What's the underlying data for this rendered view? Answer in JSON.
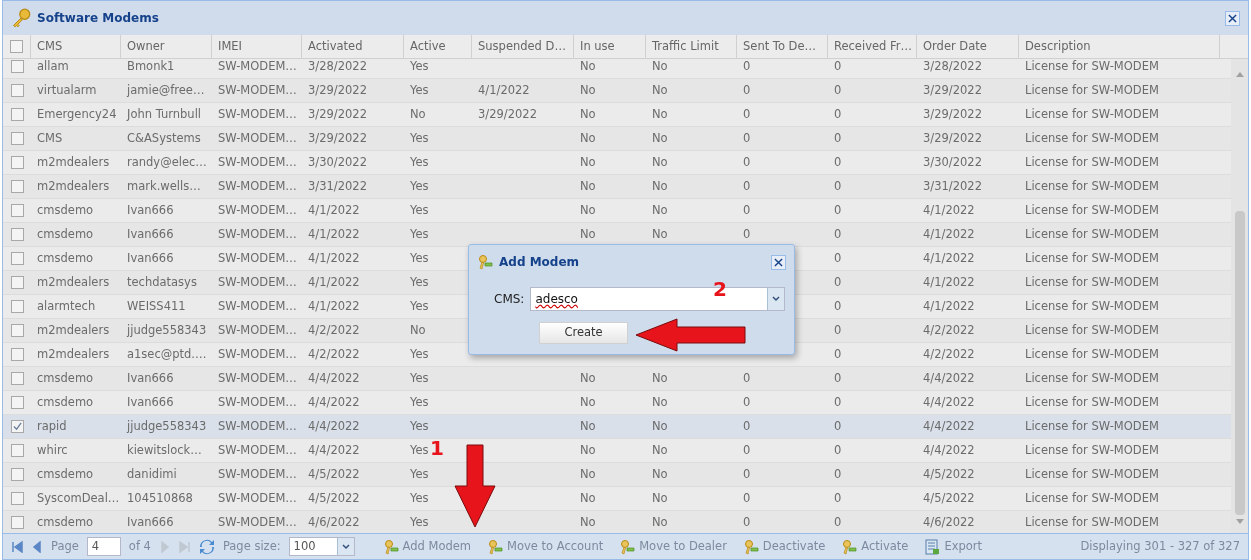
{
  "window": {
    "title": "Software Modems"
  },
  "table": {
    "columns": [
      "CMS",
      "Owner",
      "IMEI",
      "Activated",
      "Active",
      "Suspended D…",
      "In use",
      "Traffic Limit",
      "Sent To De…",
      "Received Fr…",
      "Order Date",
      "Description"
    ],
    "header_checked": false,
    "rows": [
      {
        "checked": false,
        "selected": false,
        "cells": [
          "allam",
          "Bmonk1",
          "SW-MODEM…",
          "3/28/2022",
          "Yes",
          "",
          "No",
          "No",
          "0",
          "0",
          "3/28/2022",
          "License for SW-MODEM"
        ]
      },
      {
        "checked": false,
        "selected": false,
        "cells": [
          "virtualarm",
          "jamie@free…",
          "SW-MODEM…",
          "3/29/2022",
          "Yes",
          "4/1/2022",
          "No",
          "No",
          "0",
          "0",
          "3/29/2022",
          "License for SW-MODEM"
        ]
      },
      {
        "checked": false,
        "selected": false,
        "cells": [
          "Emergency24",
          "John Turnbull",
          "SW-MODEM…",
          "3/29/2022",
          "No",
          "3/29/2022",
          "No",
          "No",
          "0",
          "0",
          "3/29/2022",
          "License for SW-MODEM"
        ]
      },
      {
        "checked": false,
        "selected": false,
        "cells": [
          "CMS",
          "C&ASystems",
          "SW-MODEM…",
          "3/29/2022",
          "Yes",
          "",
          "No",
          "No",
          "0",
          "0",
          "3/29/2022",
          "License for SW-MODEM"
        ]
      },
      {
        "checked": false,
        "selected": false,
        "cells": [
          "m2mdealers",
          "randy@elec…",
          "SW-MODEM…",
          "3/30/2022",
          "Yes",
          "",
          "No",
          "No",
          "0",
          "0",
          "3/30/2022",
          "License for SW-MODEM"
        ]
      },
      {
        "checked": false,
        "selected": false,
        "cells": [
          "m2mdealers",
          "mark.wells…",
          "SW-MODEM…",
          "3/31/2022",
          "Yes",
          "",
          "No",
          "No",
          "0",
          "0",
          "3/31/2022",
          "License for SW-MODEM"
        ]
      },
      {
        "checked": false,
        "selected": false,
        "cells": [
          "cmsdemo",
          "Ivan666",
          "SW-MODEM…",
          "4/1/2022",
          "Yes",
          "",
          "No",
          "No",
          "0",
          "0",
          "4/1/2022",
          "License for SW-MODEM"
        ]
      },
      {
        "checked": false,
        "selected": false,
        "cells": [
          "cmsdemo",
          "Ivan666",
          "SW-MODEM…",
          "4/1/2022",
          "Yes",
          "",
          "No",
          "No",
          "0",
          "0",
          "4/1/2022",
          "License for SW-MODEM"
        ]
      },
      {
        "checked": false,
        "selected": false,
        "cells": [
          "cmsdemo",
          "Ivan666",
          "SW-MODEM…",
          "4/1/2022",
          "Yes",
          "",
          null,
          null,
          null,
          "0",
          "4/1/2022",
          "License for SW-MODEM"
        ]
      },
      {
        "checked": false,
        "selected": false,
        "cells": [
          "m2mdealers",
          "techdatasys",
          "SW-MODEM…",
          "4/1/2022",
          "Yes",
          "",
          null,
          null,
          null,
          "0",
          "4/1/2022",
          "License for SW-MODEM"
        ]
      },
      {
        "checked": false,
        "selected": false,
        "cells": [
          "alarmtech",
          "WEISS411",
          "SW-MODEM…",
          "4/1/2022",
          "Yes",
          "",
          null,
          null,
          null,
          "0",
          "4/1/2022",
          "License for SW-MODEM"
        ]
      },
      {
        "checked": false,
        "selected": false,
        "cells": [
          "m2mdealers",
          "jjudge558343",
          "SW-MODEM…",
          "4/2/2022",
          "No",
          "",
          null,
          null,
          null,
          "0",
          "4/2/2022",
          "License for SW-MODEM"
        ]
      },
      {
        "checked": false,
        "selected": false,
        "cells": [
          "m2mdealers",
          "a1sec@ptd.…",
          "SW-MODEM…",
          "4/2/2022",
          "Yes",
          "",
          null,
          null,
          null,
          "0",
          "4/2/2022",
          "License for SW-MODEM"
        ]
      },
      {
        "checked": false,
        "selected": false,
        "cells": [
          "cmsdemo",
          "Ivan666",
          "SW-MODEM…",
          "4/4/2022",
          "Yes",
          "",
          "No",
          "No",
          "0",
          "0",
          "4/4/2022",
          "License for SW-MODEM"
        ]
      },
      {
        "checked": false,
        "selected": false,
        "cells": [
          "cmsdemo",
          "Ivan666",
          "SW-MODEM…",
          "4/4/2022",
          "Yes",
          "",
          "No",
          "No",
          "0",
          "0",
          "4/4/2022",
          "License for SW-MODEM"
        ]
      },
      {
        "checked": true,
        "selected": true,
        "cells": [
          "rapid",
          "jjudge558343",
          "SW-MODEM…",
          "4/4/2022",
          "Yes",
          "",
          "No",
          "No",
          "0",
          "0",
          "4/4/2022",
          "License for SW-MODEM"
        ]
      },
      {
        "checked": false,
        "selected": false,
        "cells": [
          "whirc",
          "kiewitslock…",
          "SW-MODEM…",
          "4/4/2022",
          "Yes",
          "",
          "No",
          "No",
          "0",
          "0",
          "4/4/2022",
          "License for SW-MODEM"
        ]
      },
      {
        "checked": false,
        "selected": false,
        "cells": [
          "cmsdemo",
          "danidimi",
          "SW-MODEM…",
          "4/5/2022",
          "Yes",
          "",
          "No",
          "No",
          "0",
          "0",
          "4/5/2022",
          "License for SW-MODEM"
        ]
      },
      {
        "checked": false,
        "selected": false,
        "cells": [
          "SyscomDeal…",
          "104510868",
          "SW-MODEM…",
          "4/5/2022",
          "Yes",
          "",
          "No",
          "No",
          "0",
          "0",
          "4/5/2022",
          "License for SW-MODEM"
        ]
      },
      {
        "checked": false,
        "selected": false,
        "cells": [
          "cmsdemo",
          "Ivan666",
          "SW-MODEM…",
          "4/6/2022",
          "Yes",
          "",
          "No",
          "No",
          "0",
          "0",
          "4/6/2022",
          "License for SW-MODEM"
        ]
      }
    ]
  },
  "pager": {
    "page_label": "Page",
    "page": "4",
    "of": "of 4",
    "first_disabled": false,
    "prev_disabled": false,
    "next_disabled": true,
    "last_disabled": true,
    "page_size_label": "Page size:",
    "page_size": "100",
    "status": "Displaying 301 - 327 of 327"
  },
  "actions": [
    {
      "label": "Add Modem",
      "kind": "keys"
    },
    {
      "label": "Move to Account",
      "kind": "keys"
    },
    {
      "label": "Move to Dealer",
      "kind": "keys"
    },
    {
      "label": "Deactivate",
      "kind": "keys"
    },
    {
      "label": "Activate",
      "kind": "keys"
    },
    {
      "label": "Export",
      "kind": "sheet"
    }
  ],
  "dialog": {
    "title": "Add Modem",
    "field_label": "CMS:",
    "field_value": "adesco",
    "buttons": [
      "Create"
    ]
  },
  "markers": [
    {
      "label": "1"
    },
    {
      "label": "2"
    }
  ]
}
